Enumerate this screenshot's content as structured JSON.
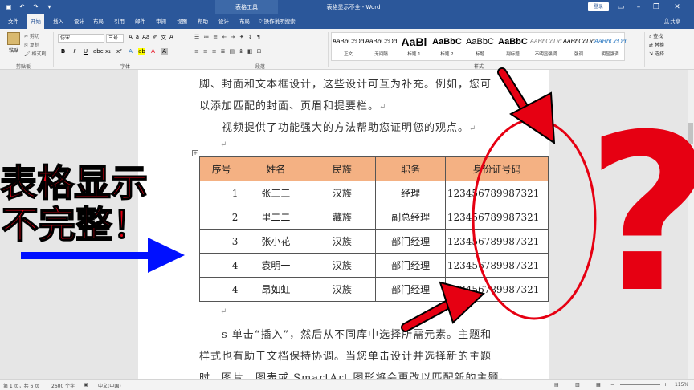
{
  "titlebar": {
    "context_tab": "表格工具",
    "doc_title": "表格显示不全 - Word",
    "login": "登录"
  },
  "menu": {
    "tabs": [
      "文件",
      "开始",
      "插入",
      "设计",
      "布局",
      "引用",
      "邮件",
      "审阅",
      "视图",
      "帮助",
      "设计",
      "布局"
    ],
    "active_index": 1,
    "tell_me": "操作说明搜索",
    "share": "共享"
  },
  "ribbon": {
    "clipboard": {
      "paste": "粘贴",
      "cut": "剪切",
      "copy": "复制",
      "format_painter": "格式刷",
      "group": "剪贴板"
    },
    "font": {
      "name": "仿宋",
      "size": "三号",
      "group": "字体",
      "bold": "B",
      "italic": "I",
      "underline": "U"
    },
    "paragraph": {
      "group": "段落"
    },
    "styles": {
      "group": "样式",
      "items": [
        {
          "sample": "AaBbCcDd",
          "name": "正文"
        },
        {
          "sample": "AaBbCcDd",
          "name": "无间隔"
        },
        {
          "sample": "AaBl",
          "name": "标题 1"
        },
        {
          "sample": "AaBbC",
          "name": "标题 2"
        },
        {
          "sample": "AaBbC",
          "name": "标题"
        },
        {
          "sample": "AaBbC",
          "name": "副标题"
        },
        {
          "sample": "AaBbCcDd",
          "name": "不明显强调"
        },
        {
          "sample": "AaBbCcDd",
          "name": "强调"
        },
        {
          "sample": "AaBbCcDd",
          "name": "明显强调"
        }
      ]
    },
    "editing": {
      "find": "查找",
      "replace": "替换",
      "select": "选择"
    }
  },
  "document": {
    "line1": "脚、封面和文本框设计，这些设计可互为补充。例如，您可",
    "line2": "以添加匹配的封面、页眉和提要栏。",
    "line3": "视频提供了功能强大的方法帮助您证明您的观点。",
    "line4": "s 单击“插入”，然后从不同库中选择所需元素。主题和",
    "line5": "样式也有助于文档保持协调。当您单击设计并选择新的主题",
    "line6": "时，图片、图表或 SmartArt 图形将会更改以匹配新的主题。",
    "pilcrow": "↵",
    "table": {
      "headers": [
        "序号",
        "姓名",
        "民族",
        "职务",
        "身份证号码"
      ],
      "rows": [
        [
          "1",
          "张三三",
          "汉族",
          "经理",
          "123456789987321"
        ],
        [
          "2",
          "里二二",
          "藏族",
          "副总经理",
          "123456789987321"
        ],
        [
          "3",
          "张小花",
          "汉族",
          "部门经理",
          "123456789987321"
        ],
        [
          "4",
          "袁明一",
          "汉族",
          "部门经理",
          "123456789987321"
        ],
        [
          "4",
          "昂如虹",
          "汉族",
          "部门经理",
          "123456789987321"
        ]
      ]
    }
  },
  "overlay": {
    "caption_line1": "表格显示",
    "caption_line2": "不完整！",
    "question_mark": "?"
  },
  "statusbar": {
    "page": "第 1 页，共 6 页",
    "words": "2600 个字",
    "language": "中文(中国)",
    "zoom": "115%"
  },
  "colors": {
    "accent": "#2b579a",
    "table_header": "#f4b183",
    "annotation_red": "#e60012",
    "annotation_blue": "#0010ff"
  }
}
